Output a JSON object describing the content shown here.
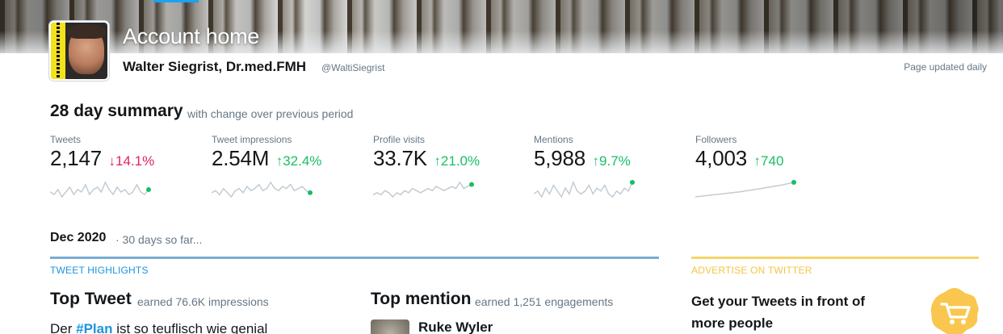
{
  "header": {
    "title": "Account home",
    "name": "Walter Siegrist, Dr.med.FMH",
    "handle": "@WaltiSiegrist",
    "page_updated": "Page updated daily"
  },
  "summary": {
    "title": "28 day summary",
    "subtitle": "with change over previous period",
    "stats": [
      {
        "label": "Tweets",
        "value": "2,147",
        "change": "14.1%",
        "direction": "down",
        "arrow": "↓",
        "trend": [
          5,
          4,
          6,
          3,
          5,
          7,
          4,
          6,
          5,
          8,
          4,
          6,
          7,
          5,
          9,
          6,
          4,
          7,
          5,
          6,
          4,
          5,
          8,
          5,
          4,
          6
        ]
      },
      {
        "label": "Tweet impressions",
        "value": "2.54M",
        "change": "32.4%",
        "direction": "up",
        "arrow": "↑",
        "trend": [
          4,
          5,
          3,
          6,
          4,
          2,
          5,
          6,
          4,
          7,
          5,
          6,
          8,
          5,
          6,
          9,
          6,
          5,
          7,
          6,
          8,
          5,
          6,
          7,
          5,
          4
        ]
      },
      {
        "label": "Profile visits",
        "value": "33.7K",
        "change": "21.0%",
        "direction": "up",
        "arrow": "↑",
        "trend": [
          4,
          5,
          4,
          6,
          5,
          3,
          5,
          4,
          6,
          5,
          7,
          6,
          5,
          6,
          7,
          6,
          8,
          7,
          6,
          7,
          8,
          7,
          10,
          7,
          8,
          9
        ]
      },
      {
        "label": "Mentions",
        "value": "5,988",
        "change": "9.7%",
        "direction": "up",
        "arrow": "↑",
        "trend": [
          5,
          6,
          4,
          7,
          5,
          8,
          6,
          4,
          7,
          5,
          9,
          6,
          5,
          6,
          8,
          5,
          7,
          6,
          8,
          5,
          4,
          6,
          5,
          7,
          6,
          9
        ]
      },
      {
        "label": "Followers",
        "value": "4,003",
        "change": "740",
        "direction": "up",
        "arrow": "↑",
        "trend": [
          1,
          1.2,
          1.4,
          1.6,
          1.8,
          2,
          2.2,
          2.4,
          2.6,
          2.8,
          3,
          3.2,
          3.5,
          3.8,
          4,
          4.3,
          4.6,
          4.9,
          5.2,
          5.5,
          5.8,
          6.1,
          6.4,
          6.8,
          7.2,
          7.6
        ]
      }
    ]
  },
  "month": {
    "label": "Dec 2020",
    "sub": "· 30 days so far..."
  },
  "highlights": {
    "section_label": "TWEET HIGHLIGHTS",
    "top_tweet_title": "Top Tweet",
    "top_tweet_sub": "earned 76.6K impressions",
    "tweet_text_before": "Der ",
    "tweet_hashtag": "#Plan",
    "tweet_text_after": " ist so teuflisch wie genial",
    "top_mention_title": "Top mention",
    "top_mention_sub": "earned 1,251 engagements",
    "mention_name": "Ruke Wyler"
  },
  "advertise": {
    "section_label": "ADVERTISE ON TWITTER",
    "text": "Get your Tweets in front of more people"
  },
  "colors": {
    "accent_blue": "#1b95e0",
    "positive": "#17bf63",
    "negative": "#e0245e",
    "ad_yellow": "#f5c542"
  }
}
